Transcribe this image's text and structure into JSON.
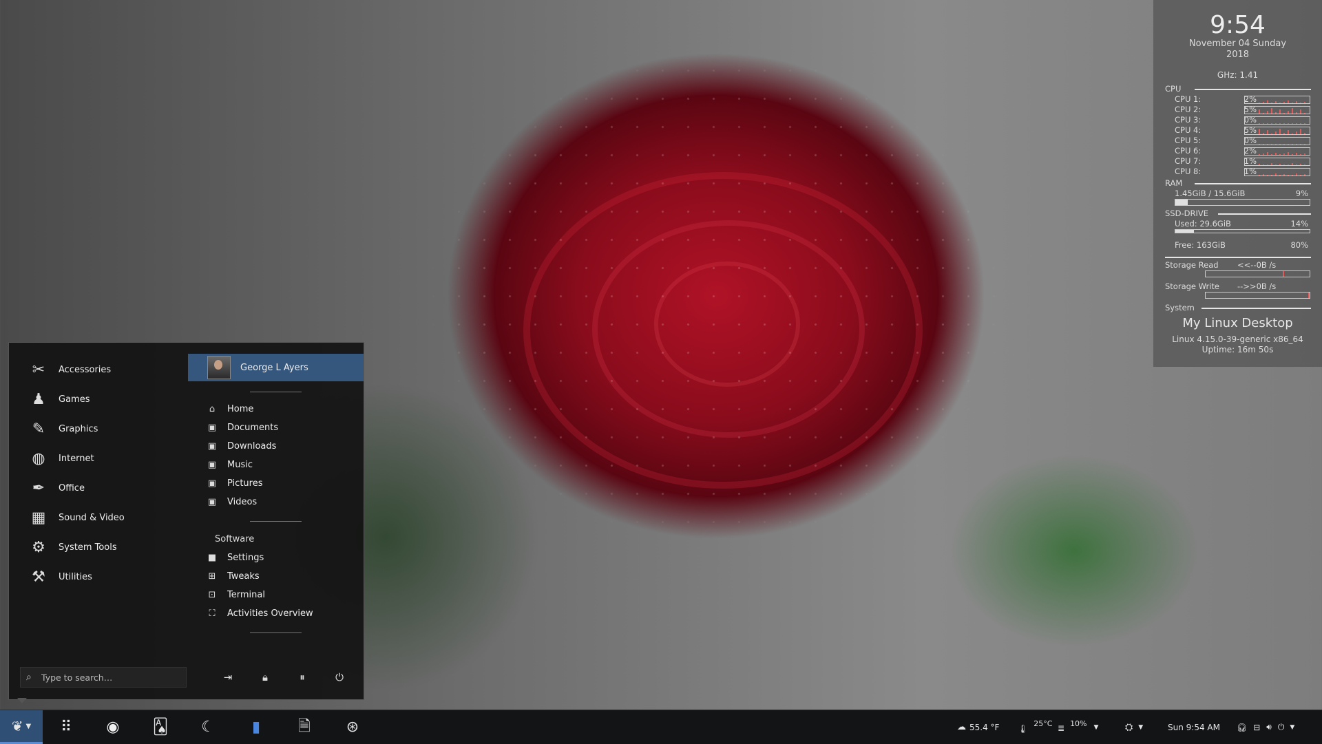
{
  "conky": {
    "time": "9:54",
    "date_line": "November 04 Sunday",
    "year": "2018",
    "ghz": "GHz: 1.41",
    "cpu_label": "CPU",
    "cpus": [
      {
        "label": "CPU 1:",
        "pct": "2%"
      },
      {
        "label": "CPU 2:",
        "pct": "5%"
      },
      {
        "label": "CPU 3:",
        "pct": "0%"
      },
      {
        "label": "CPU 4:",
        "pct": "5%"
      },
      {
        "label": "CPU 5:",
        "pct": "0%"
      },
      {
        "label": "CPU 6:",
        "pct": "2%"
      },
      {
        "label": "CPU 7:",
        "pct": "1%"
      },
      {
        "label": "CPU 8:",
        "pct": "1%"
      }
    ],
    "ram_label": "RAM",
    "ram_usage": "1.45GiB / 15.6GiB",
    "ram_pct": "9%",
    "ram_fill": 0.09,
    "ssd_label": "SSD-DRIVE",
    "ssd_used": "Used:  29.6GiB",
    "ssd_used_pct": "14%",
    "ssd_used_fill": 0.14,
    "ssd_free": "Free:  163GiB",
    "ssd_free_pct": "80%",
    "storage_read_label": "Storage Read",
    "storage_read_value": "<<--0B  /s",
    "storage_write_label": "Storage Write",
    "storage_write_value": "-->>0B  /s",
    "system_label": "System",
    "hostname": "My Linux Desktop",
    "kernel": "Linux 4.15.0-39-generic x86_64",
    "uptime": "Uptime: 16m 50s"
  },
  "menu": {
    "categories": [
      {
        "label": "Accessories",
        "icon": "accessories-icon"
      },
      {
        "label": "Games",
        "icon": "games-icon"
      },
      {
        "label": "Graphics",
        "icon": "graphics-icon"
      },
      {
        "label": "Internet",
        "icon": "internet-icon"
      },
      {
        "label": "Office",
        "icon": "office-icon"
      },
      {
        "label": "Sound & Video",
        "icon": "sound-video-icon"
      },
      {
        "label": "System Tools",
        "icon": "system-tools-icon"
      },
      {
        "label": "Utilities",
        "icon": "utilities-icon"
      }
    ],
    "user_name": "George L Ayers",
    "places": [
      {
        "label": "Home",
        "icon": "home-icon"
      },
      {
        "label": "Documents",
        "icon": "folder-icon"
      },
      {
        "label": "Downloads",
        "icon": "folder-icon"
      },
      {
        "label": "Music",
        "icon": "folder-icon"
      },
      {
        "label": "Pictures",
        "icon": "folder-icon"
      },
      {
        "label": "Videos",
        "icon": "folder-icon"
      }
    ],
    "software_heading": "Software",
    "apps": [
      {
        "label": "Settings",
        "icon": "settings-icon"
      },
      {
        "label": "Tweaks",
        "icon": "tweaks-icon"
      },
      {
        "label": "Terminal",
        "icon": "terminal-icon"
      },
      {
        "label": "Activities Overview",
        "icon": "activities-icon"
      }
    ],
    "search_placeholder": "Type to search…",
    "system_buttons": [
      "logout-icon",
      "lock-icon",
      "suspend-icon",
      "power-icon"
    ]
  },
  "taskbar": {
    "launchers": [
      "apps-grid-icon",
      "firefox-icon",
      "solitaire-icon",
      "system-monitor-icon",
      "files-icon",
      "document-viewer-icon",
      "help-icon"
    ],
    "weather": "55.4 °F",
    "cpu_temp": "25°C",
    "disk_pct": "10%",
    "clock": "Sun  9:54 AM"
  }
}
